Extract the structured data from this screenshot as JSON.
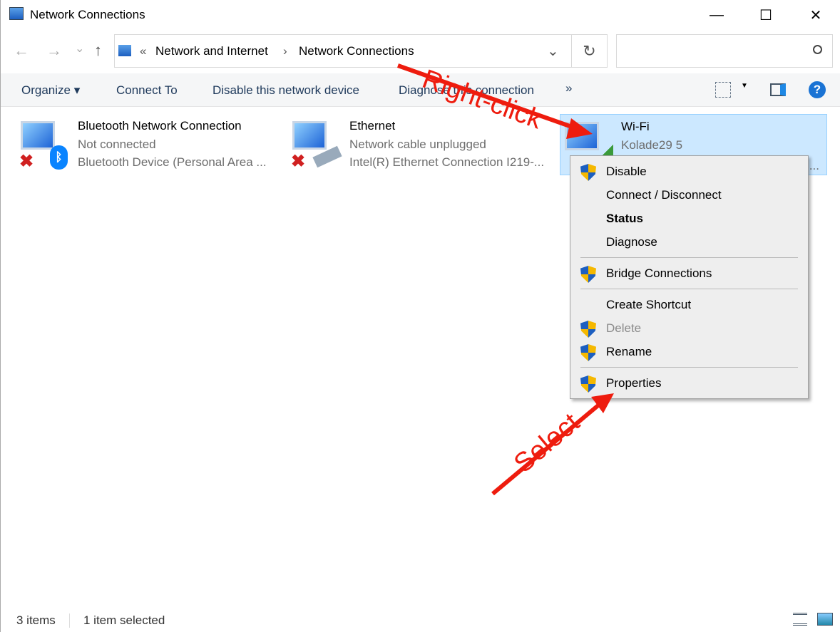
{
  "window": {
    "title": "Network Connections",
    "minimize": "—",
    "maximize": "☐",
    "close": "✕"
  },
  "nav": {
    "back": "←",
    "forward": "→",
    "recent": "⌄",
    "up": "↑",
    "breadcrumb": [
      "Network and Internet",
      "Network Connections"
    ],
    "overflow": "«",
    "sep": "›",
    "dropdown": "⌄",
    "refresh": "↻",
    "search_placeholder": ""
  },
  "toolbar": {
    "organize": "Organize ▾",
    "connect_to": "Connect To",
    "disable": "Disable this network device",
    "diagnose": "Diagnose this connection",
    "more": "»",
    "help": "?"
  },
  "items": [
    {
      "name": "Bluetooth Network Connection",
      "status": "Not connected",
      "device": "Bluetooth Device (Personal Area ..."
    },
    {
      "name": "Ethernet",
      "status": "Network cable unplugged",
      "device": "Intel(R) Ethernet Connection I219-..."
    },
    {
      "name": "Wi-Fi",
      "status": "Kolade29 5",
      "device": "..."
    }
  ],
  "context_menu": [
    {
      "label": "Disable",
      "shield": true
    },
    {
      "label": "Connect / Disconnect",
      "shield": false
    },
    {
      "label": "Status",
      "shield": false,
      "bold": true
    },
    {
      "label": "Diagnose",
      "shield": false
    },
    {
      "label": "Bridge Connections",
      "shield": true
    },
    {
      "label": "Create Shortcut",
      "shield": false
    },
    {
      "label": "Delete",
      "shield": true,
      "disabled": true
    },
    {
      "label": "Rename",
      "shield": true
    },
    {
      "label": "Properties",
      "shield": true
    }
  ],
  "annotations": {
    "right_click": "Right-click",
    "select": "Select"
  },
  "statusbar": {
    "count": "3 items",
    "selected": "1 item selected"
  },
  "colors": {
    "selection": "#cce8ff",
    "annotation": "#ee1c0e"
  }
}
